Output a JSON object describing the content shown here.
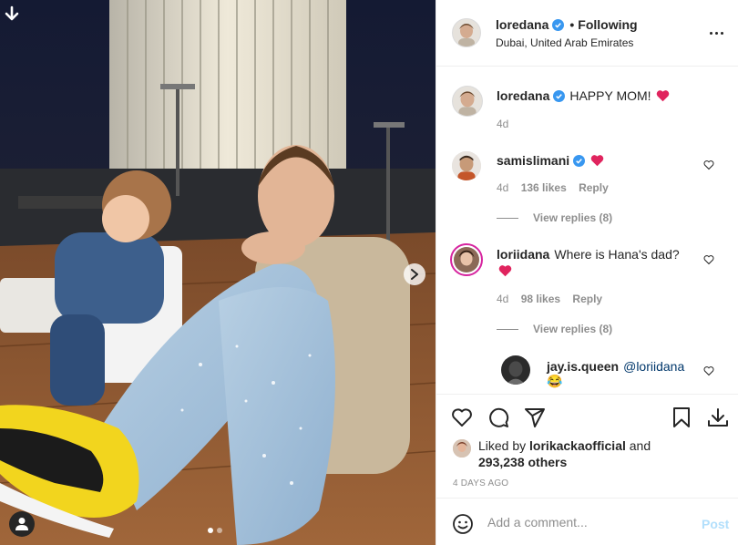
{
  "post": {
    "author": "loredana",
    "follow_separator": "•",
    "follow_status": "Following",
    "location": "Dubai, United Arab Emirates",
    "caption": "HAPPY MOM!",
    "caption_age": "4d"
  },
  "comments": [
    {
      "user": "samislimani",
      "verified": true,
      "text": "",
      "age": "4d",
      "likes": "136 likes",
      "reply_label": "Reply",
      "view_replies": "View replies (8)"
    },
    {
      "user": "loriidana",
      "verified": false,
      "text": "Where is Hana's dad?",
      "age": "4d",
      "likes": "98 likes",
      "reply_label": "Reply",
      "view_replies": "View replies (8)"
    },
    {
      "user": "jay.is.queen",
      "verified": false,
      "mention": "@loriidana",
      "emoji": "😂"
    }
  ],
  "likes": {
    "prefix": "Liked by",
    "user": "lorikackaofficial",
    "joiner": "and",
    "count": "293,238 others"
  },
  "timestamp": "4 DAYS AGO",
  "composer": {
    "placeholder": "Add a comment...",
    "post_label": "Post"
  },
  "carousel": {
    "slides": 2,
    "active": 0
  },
  "colors": {
    "verified": "#3897f0",
    "heart": "#ed4956",
    "mention": "#00376b",
    "post_disabled": "#b2dffc",
    "muted": "#8e8e8e"
  },
  "icons": [
    "download-corner-icon",
    "chevron-right-icon",
    "user-tag-icon",
    "verified-badge-icon",
    "more-options-icon",
    "heart-icon",
    "comment-icon",
    "share-icon",
    "bookmark-icon",
    "download-icon",
    "emoji-icon"
  ]
}
